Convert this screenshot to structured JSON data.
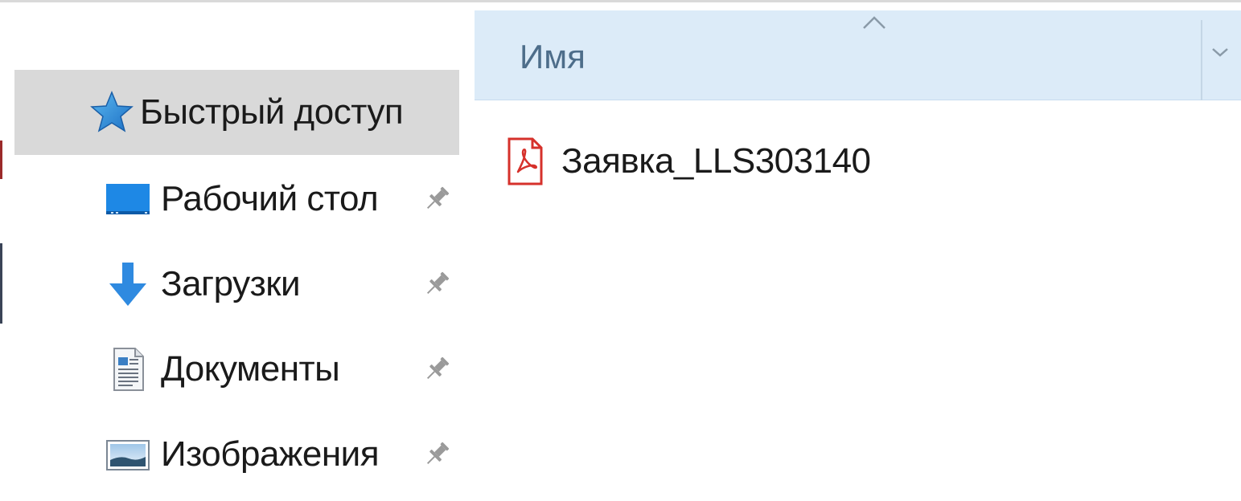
{
  "navigation": {
    "quick_access": {
      "label": "Быстрый доступ",
      "icon": "star-icon"
    },
    "items": [
      {
        "label": "Рабочий стол",
        "icon": "desktop-icon",
        "pinned": true
      },
      {
        "label": "Загрузки",
        "icon": "download-arrow-icon",
        "pinned": true
      },
      {
        "label": "Документы",
        "icon": "document-icon",
        "pinned": true
      },
      {
        "label": "Изображения",
        "icon": "pictures-icon",
        "pinned": true
      }
    ]
  },
  "file_list": {
    "column_header": "Имя",
    "sort": "ascending",
    "files": [
      {
        "name": "Заявка_LLS303140",
        "icon": "pdf-file-icon"
      }
    ]
  },
  "colors": {
    "quick_access_highlight": "#d9d9d9",
    "column_header_bg": "#dcebf8",
    "column_header_text": "#4d6d8a",
    "pdf_red": "#d6312b",
    "folder_blue": "#1e88e5"
  }
}
